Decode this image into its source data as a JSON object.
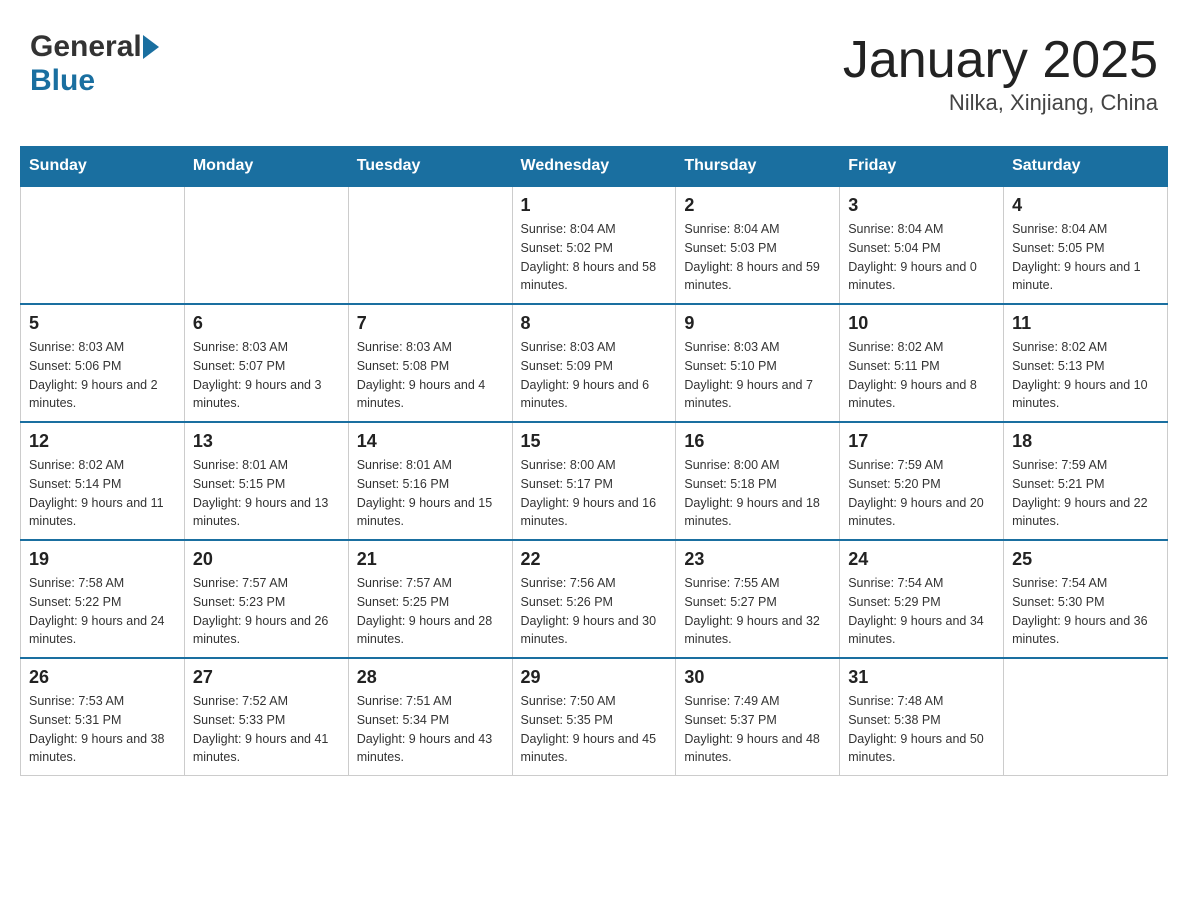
{
  "header": {
    "logo_general": "General",
    "logo_blue": "Blue",
    "month_title": "January 2025",
    "location": "Nilka, Xinjiang, China"
  },
  "days_of_week": [
    "Sunday",
    "Monday",
    "Tuesday",
    "Wednesday",
    "Thursday",
    "Friday",
    "Saturday"
  ],
  "weeks": [
    [
      {
        "day": "",
        "info": ""
      },
      {
        "day": "",
        "info": ""
      },
      {
        "day": "",
        "info": ""
      },
      {
        "day": "1",
        "info": "Sunrise: 8:04 AM\nSunset: 5:02 PM\nDaylight: 8 hours and 58 minutes."
      },
      {
        "day": "2",
        "info": "Sunrise: 8:04 AM\nSunset: 5:03 PM\nDaylight: 8 hours and 59 minutes."
      },
      {
        "day": "3",
        "info": "Sunrise: 8:04 AM\nSunset: 5:04 PM\nDaylight: 9 hours and 0 minutes."
      },
      {
        "day": "4",
        "info": "Sunrise: 8:04 AM\nSunset: 5:05 PM\nDaylight: 9 hours and 1 minute."
      }
    ],
    [
      {
        "day": "5",
        "info": "Sunrise: 8:03 AM\nSunset: 5:06 PM\nDaylight: 9 hours and 2 minutes."
      },
      {
        "day": "6",
        "info": "Sunrise: 8:03 AM\nSunset: 5:07 PM\nDaylight: 9 hours and 3 minutes."
      },
      {
        "day": "7",
        "info": "Sunrise: 8:03 AM\nSunset: 5:08 PM\nDaylight: 9 hours and 4 minutes."
      },
      {
        "day": "8",
        "info": "Sunrise: 8:03 AM\nSunset: 5:09 PM\nDaylight: 9 hours and 6 minutes."
      },
      {
        "day": "9",
        "info": "Sunrise: 8:03 AM\nSunset: 5:10 PM\nDaylight: 9 hours and 7 minutes."
      },
      {
        "day": "10",
        "info": "Sunrise: 8:02 AM\nSunset: 5:11 PM\nDaylight: 9 hours and 8 minutes."
      },
      {
        "day": "11",
        "info": "Sunrise: 8:02 AM\nSunset: 5:13 PM\nDaylight: 9 hours and 10 minutes."
      }
    ],
    [
      {
        "day": "12",
        "info": "Sunrise: 8:02 AM\nSunset: 5:14 PM\nDaylight: 9 hours and 11 minutes."
      },
      {
        "day": "13",
        "info": "Sunrise: 8:01 AM\nSunset: 5:15 PM\nDaylight: 9 hours and 13 minutes."
      },
      {
        "day": "14",
        "info": "Sunrise: 8:01 AM\nSunset: 5:16 PM\nDaylight: 9 hours and 15 minutes."
      },
      {
        "day": "15",
        "info": "Sunrise: 8:00 AM\nSunset: 5:17 PM\nDaylight: 9 hours and 16 minutes."
      },
      {
        "day": "16",
        "info": "Sunrise: 8:00 AM\nSunset: 5:18 PM\nDaylight: 9 hours and 18 minutes."
      },
      {
        "day": "17",
        "info": "Sunrise: 7:59 AM\nSunset: 5:20 PM\nDaylight: 9 hours and 20 minutes."
      },
      {
        "day": "18",
        "info": "Sunrise: 7:59 AM\nSunset: 5:21 PM\nDaylight: 9 hours and 22 minutes."
      }
    ],
    [
      {
        "day": "19",
        "info": "Sunrise: 7:58 AM\nSunset: 5:22 PM\nDaylight: 9 hours and 24 minutes."
      },
      {
        "day": "20",
        "info": "Sunrise: 7:57 AM\nSunset: 5:23 PM\nDaylight: 9 hours and 26 minutes."
      },
      {
        "day": "21",
        "info": "Sunrise: 7:57 AM\nSunset: 5:25 PM\nDaylight: 9 hours and 28 minutes."
      },
      {
        "day": "22",
        "info": "Sunrise: 7:56 AM\nSunset: 5:26 PM\nDaylight: 9 hours and 30 minutes."
      },
      {
        "day": "23",
        "info": "Sunrise: 7:55 AM\nSunset: 5:27 PM\nDaylight: 9 hours and 32 minutes."
      },
      {
        "day": "24",
        "info": "Sunrise: 7:54 AM\nSunset: 5:29 PM\nDaylight: 9 hours and 34 minutes."
      },
      {
        "day": "25",
        "info": "Sunrise: 7:54 AM\nSunset: 5:30 PM\nDaylight: 9 hours and 36 minutes."
      }
    ],
    [
      {
        "day": "26",
        "info": "Sunrise: 7:53 AM\nSunset: 5:31 PM\nDaylight: 9 hours and 38 minutes."
      },
      {
        "day": "27",
        "info": "Sunrise: 7:52 AM\nSunset: 5:33 PM\nDaylight: 9 hours and 41 minutes."
      },
      {
        "day": "28",
        "info": "Sunrise: 7:51 AM\nSunset: 5:34 PM\nDaylight: 9 hours and 43 minutes."
      },
      {
        "day": "29",
        "info": "Sunrise: 7:50 AM\nSunset: 5:35 PM\nDaylight: 9 hours and 45 minutes."
      },
      {
        "day": "30",
        "info": "Sunrise: 7:49 AM\nSunset: 5:37 PM\nDaylight: 9 hours and 48 minutes."
      },
      {
        "day": "31",
        "info": "Sunrise: 7:48 AM\nSunset: 5:38 PM\nDaylight: 9 hours and 50 minutes."
      },
      {
        "day": "",
        "info": ""
      }
    ]
  ]
}
